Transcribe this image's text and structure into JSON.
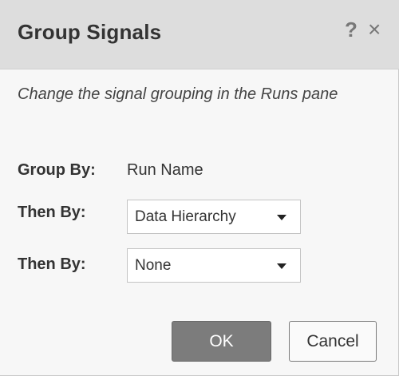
{
  "dialog": {
    "title": "Group Signals",
    "help_label": "?",
    "close_label": "×",
    "description": "Change the signal grouping in the Runs pane"
  },
  "group_by": {
    "label": "Group By:",
    "value": "Run Name"
  },
  "then_by_1": {
    "label": "Then By:",
    "selected": "Data Hierarchy"
  },
  "then_by_2": {
    "label": "Then By:",
    "selected": "None"
  },
  "buttons": {
    "ok_label": "OK",
    "cancel_label": "Cancel"
  },
  "colors": {
    "titlebar_bg": "#dddddd",
    "body_bg": "#f7f7f7",
    "ok_bg": "#7c7c7c"
  }
}
